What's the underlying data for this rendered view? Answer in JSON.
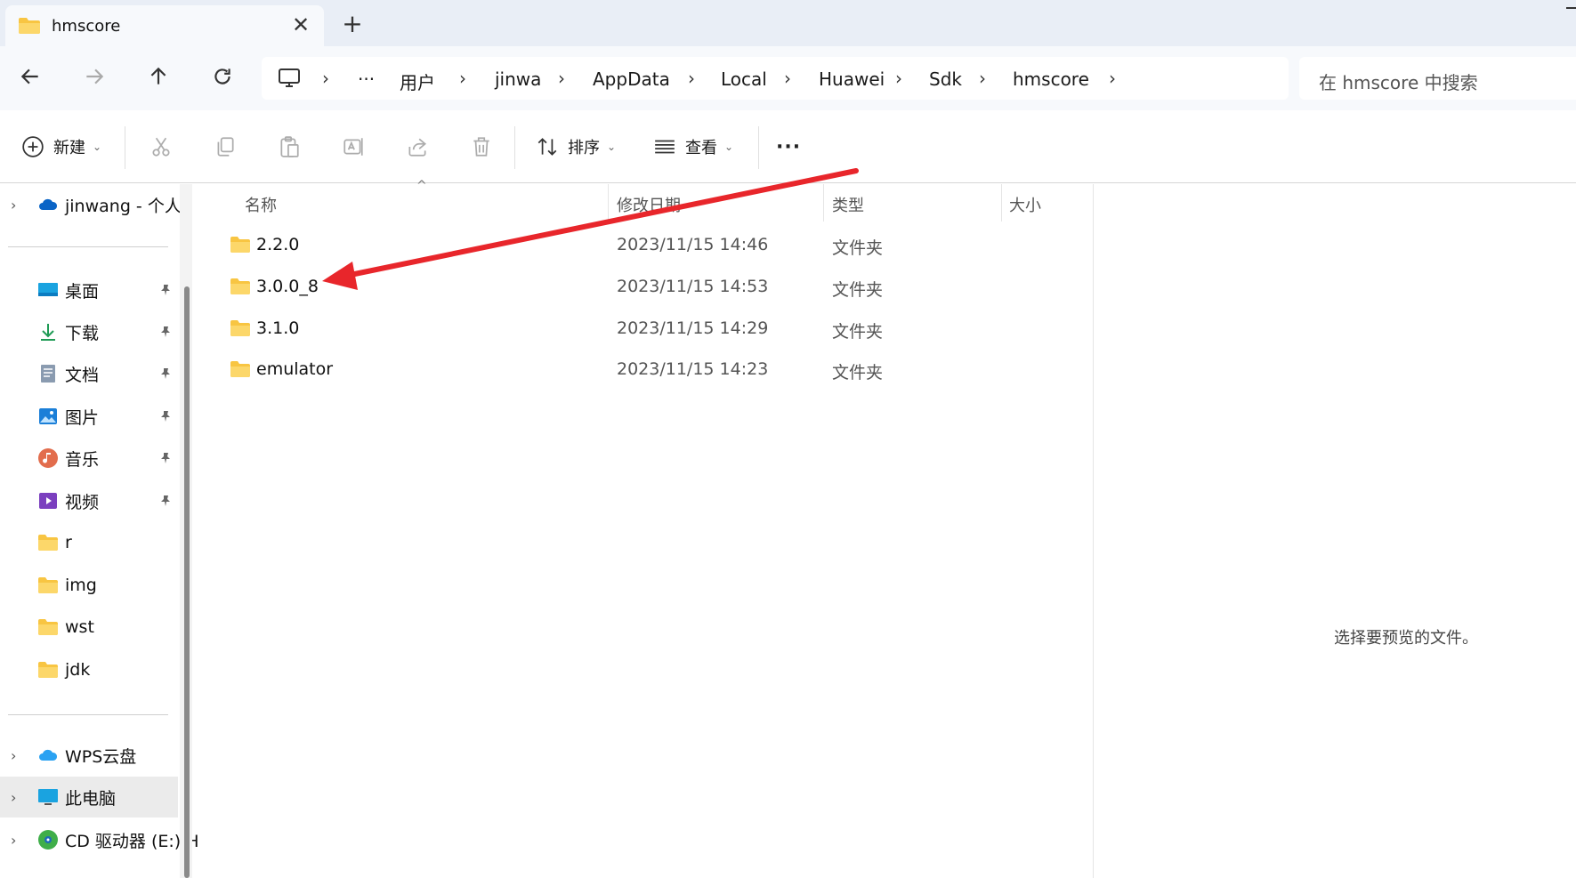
{
  "tab": {
    "title": "hmscore",
    "close_icon": "close-icon",
    "new_tab_label": "+"
  },
  "address": {
    "ellipsis": "···",
    "crumbs": [
      "用户",
      "jinwa",
      "AppData",
      "Local",
      "Huawei",
      "Sdk",
      "hmscore"
    ],
    "search_placeholder": "在 hmscore 中搜索"
  },
  "toolbar": {
    "new_label": "新建",
    "sort_label": "排序",
    "view_label": "查看",
    "more_label": "···"
  },
  "sidebar": {
    "onedrive": "jinwang - 个人",
    "quick_access": [
      {
        "label": "桌面",
        "icon": "desktop-icon",
        "pinned": true
      },
      {
        "label": "下载",
        "icon": "download-icon",
        "pinned": true
      },
      {
        "label": "文档",
        "icon": "documents-icon",
        "pinned": true
      },
      {
        "label": "图片",
        "icon": "pictures-icon",
        "pinned": true
      },
      {
        "label": "音乐",
        "icon": "music-icon",
        "pinned": true
      },
      {
        "label": "视频",
        "icon": "videos-icon",
        "pinned": true
      },
      {
        "label": "r",
        "icon": "folder-icon",
        "pinned": false
      },
      {
        "label": "img",
        "icon": "folder-icon",
        "pinned": false
      },
      {
        "label": "wst",
        "icon": "folder-icon",
        "pinned": false
      },
      {
        "label": "jdk",
        "icon": "folder-icon",
        "pinned": false
      }
    ],
    "wps": "WPS云盘",
    "this_pc": "此电脑",
    "cd_drive": "CD 驱动器 (E:) H"
  },
  "columns": {
    "name": "名称",
    "date": "修改日期",
    "type": "类型",
    "size": "大小"
  },
  "files": [
    {
      "name": "2.2.0",
      "date": "2023/11/15 14:46",
      "type": "文件夹"
    },
    {
      "name": "3.0.0_8",
      "date": "2023/11/15 14:53",
      "type": "文件夹"
    },
    {
      "name": "3.1.0",
      "date": "2023/11/15 14:29",
      "type": "文件夹"
    },
    {
      "name": "emulator",
      "date": "2023/11/15 14:23",
      "type": "文件夹"
    }
  ],
  "preview": {
    "message": "选择要预览的文件。"
  },
  "colors": {
    "accent": "#0067c0",
    "annotation_arrow": "#e8262b",
    "folder_yellow": "#f8c542"
  }
}
